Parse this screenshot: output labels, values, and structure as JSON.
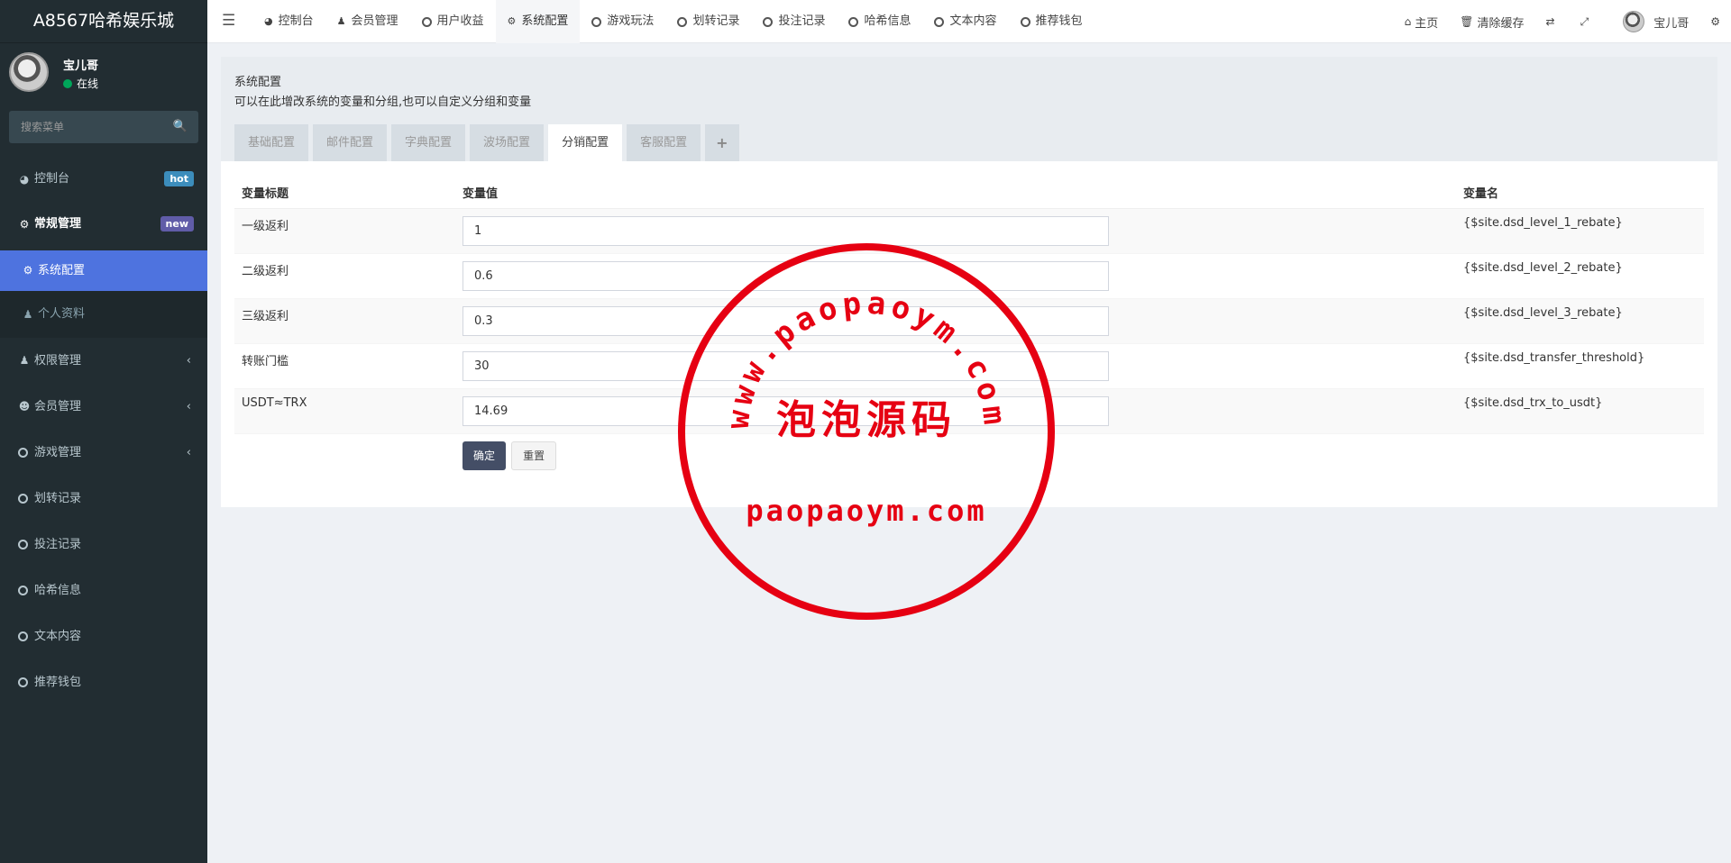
{
  "app": {
    "title": "A8567哈希娱乐城"
  },
  "user": {
    "name": "宝儿哥",
    "status": "在线"
  },
  "sidebar": {
    "search_placeholder": "搜索菜单",
    "items": [
      {
        "label": "控制台",
        "icon": "dashboard-icon",
        "badge": "hot",
        "badge_color": "#3c8dbc"
      },
      {
        "label": "常规管理",
        "icon": "cogs-icon",
        "badge": "new",
        "badge_color": "#605ca8"
      },
      {
        "label": "系统配置",
        "icon": "gear-icon"
      },
      {
        "label": "个人资料",
        "icon": "user-icon"
      },
      {
        "label": "权限管理",
        "icon": "users-icon"
      },
      {
        "label": "会员管理",
        "icon": "user-circle-icon"
      },
      {
        "label": "游戏管理",
        "icon": "circle-icon"
      },
      {
        "label": "划转记录",
        "icon": "circle-icon"
      },
      {
        "label": "投注记录",
        "icon": "circle-icon"
      },
      {
        "label": "哈希信息",
        "icon": "circle-icon"
      },
      {
        "label": "文本内容",
        "icon": "circle-icon"
      },
      {
        "label": "推荐钱包",
        "icon": "circle-icon"
      }
    ]
  },
  "header": {
    "tabs": [
      {
        "label": "控制台"
      },
      {
        "label": "会员管理"
      },
      {
        "label": "用户收益"
      },
      {
        "label": "系统配置"
      },
      {
        "label": "游戏玩法"
      },
      {
        "label": "划转记录"
      },
      {
        "label": "投注记录"
      },
      {
        "label": "哈希信息"
      },
      {
        "label": "文本内容"
      },
      {
        "label": "推荐钱包"
      }
    ],
    "right": {
      "home": "主页",
      "clear_cache": "清除缓存",
      "user": "宝儿哥"
    }
  },
  "panel": {
    "title": "系统配置",
    "description": "可以在此增改系统的变量和分组,也可以自定义分组和变量",
    "tabs": [
      "基础配置",
      "邮件配置",
      "字典配置",
      "波场配置",
      "分销配置",
      "客服配置",
      "+"
    ],
    "active_tab": "分销配置",
    "table": {
      "headers": {
        "title": "变量标题",
        "value": "变量值",
        "name": "变量名"
      },
      "rows": [
        {
          "title": "一级返利",
          "value": "1",
          "name": "{$site.dsd_level_1_rebate}"
        },
        {
          "title": "二级返利",
          "value": "0.6",
          "name": "{$site.dsd_level_2_rebate}"
        },
        {
          "title": "三级返利",
          "value": "0.3",
          "name": "{$site.dsd_level_3_rebate}"
        },
        {
          "title": "转账门槛",
          "value": "30",
          "name": "{$site.dsd_transfer_threshold}"
        },
        {
          "title": "USDT≈TRX",
          "value": "14.69",
          "name": "{$site.dsd_trx_to_usdt}"
        }
      ]
    },
    "buttons": {
      "ok": "确定",
      "reset": "重置"
    }
  },
  "watermark": {
    "arc_text": "www.paopaoym.com",
    "center_text": "泡泡源码",
    "bottom_text": "paopaoym.com",
    "color": "#e60012"
  }
}
